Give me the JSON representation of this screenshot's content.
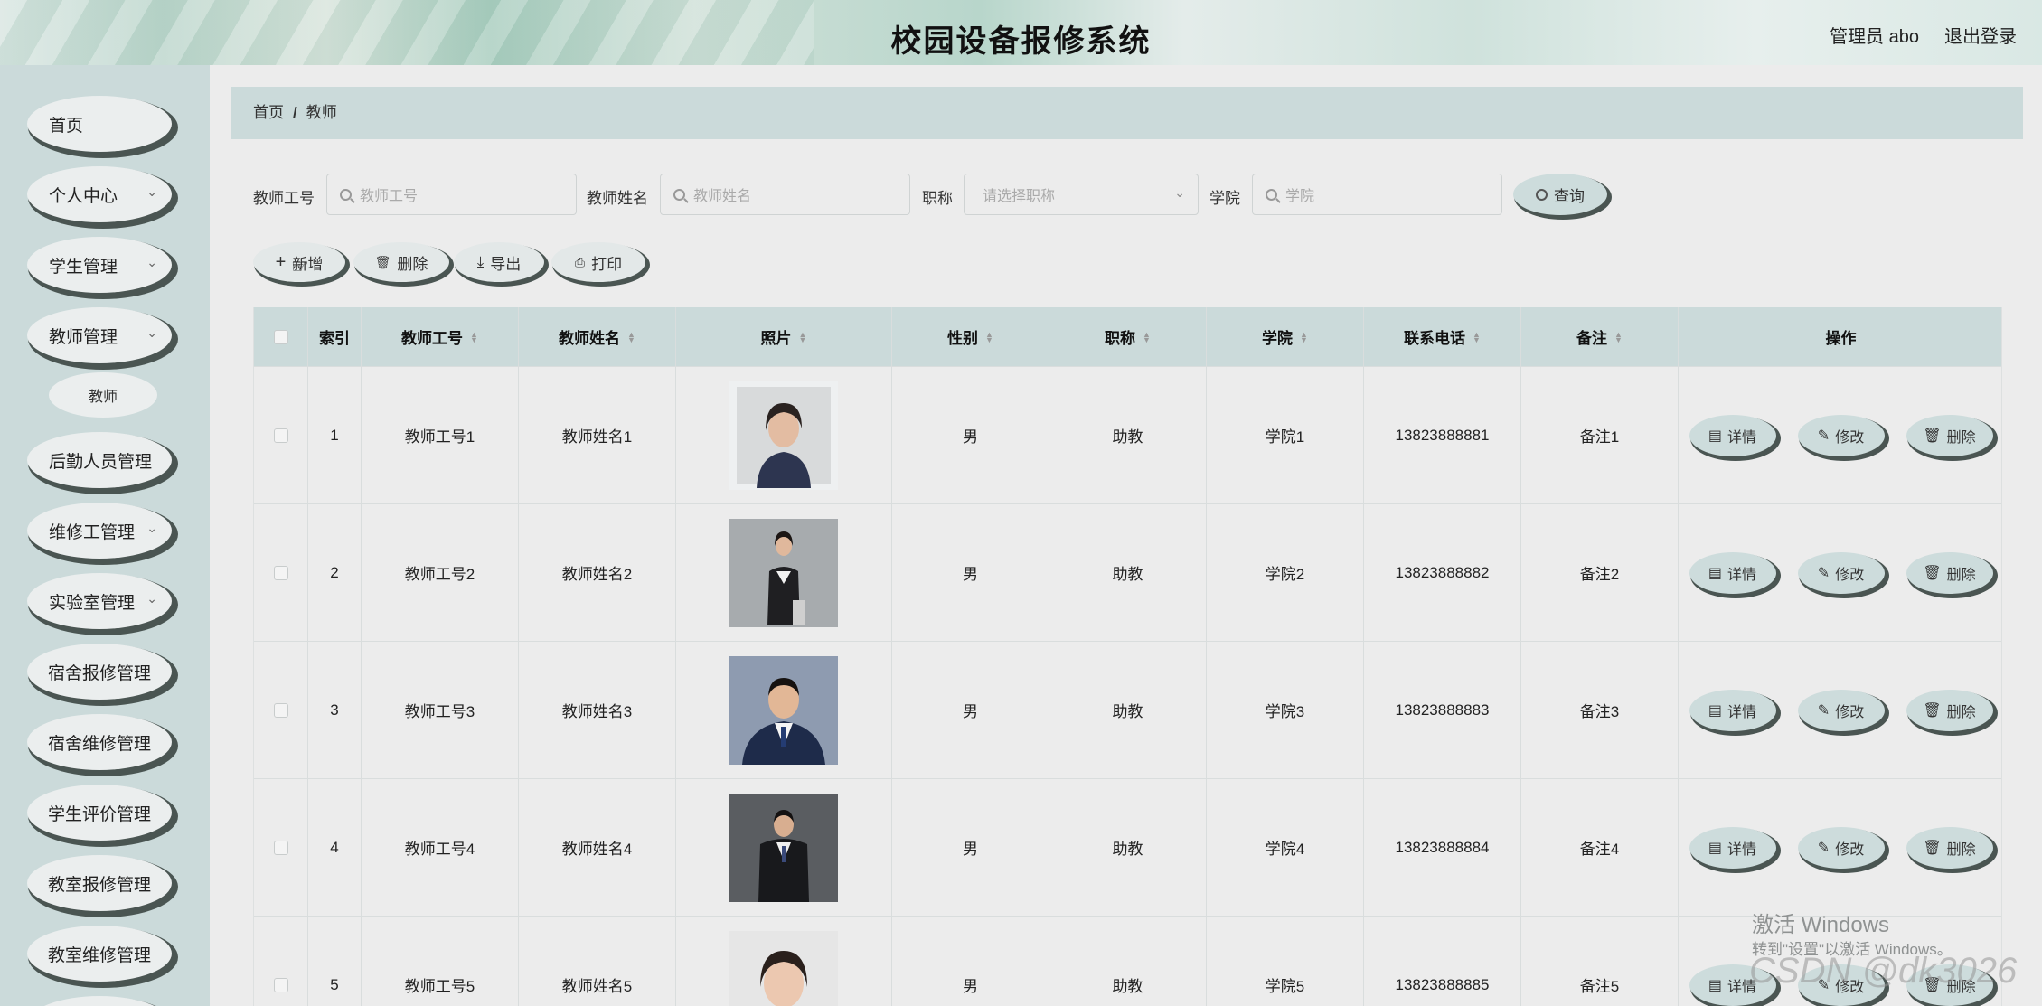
{
  "header": {
    "title": "校园设备报修系统",
    "user": "管理员 abo",
    "logout": "退出登录"
  },
  "sidebar": {
    "items": [
      {
        "label": "首页",
        "chevron": false
      },
      {
        "label": "个人中心",
        "chevron": true
      },
      {
        "label": "学生管理",
        "chevron": true
      },
      {
        "label": "教师管理",
        "chevron": true
      },
      {
        "label": "后勤人员管理",
        "chevron": false
      },
      {
        "label": "维修工管理",
        "chevron": true
      },
      {
        "label": "实验室管理",
        "chevron": true
      },
      {
        "label": "宿舍报修管理",
        "chevron": false
      },
      {
        "label": "宿舍维修管理",
        "chevron": false
      },
      {
        "label": "学生评价管理",
        "chevron": false
      },
      {
        "label": "教室报修管理",
        "chevron": false
      },
      {
        "label": "教室维修管理",
        "chevron": false
      }
    ],
    "submenu": "教师"
  },
  "breadcrumb": {
    "home": "首页",
    "sep": "/",
    "current": "教师"
  },
  "filters": {
    "no_label": "教师工号",
    "no_placeholder": "教师工号",
    "name_label": "教师姓名",
    "name_placeholder": "教师姓名",
    "title_label": "职称",
    "title_placeholder": "请选择职称",
    "college_label": "学院",
    "college_placeholder": "学院",
    "search": "查询"
  },
  "toolbar": {
    "add": "新增",
    "delete": "删除",
    "export": "导出",
    "print": "打印"
  },
  "table": {
    "columns": [
      "索引",
      "教师工号",
      "教师姓名",
      "照片",
      "性别",
      "职称",
      "学院",
      "联系电话",
      "备注",
      "操作"
    ],
    "rows": [
      {
        "idx": "1",
        "no": "教师工号1",
        "name": "教师姓名1",
        "gender": "男",
        "title": "助教",
        "college": "学院1",
        "phone": "13823888881",
        "note": "备注1"
      },
      {
        "idx": "2",
        "no": "教师工号2",
        "name": "教师姓名2",
        "gender": "男",
        "title": "助教",
        "college": "学院2",
        "phone": "13823888882",
        "note": "备注2"
      },
      {
        "idx": "3",
        "no": "教师工号3",
        "name": "教师姓名3",
        "gender": "男",
        "title": "助教",
        "college": "学院3",
        "phone": "13823888883",
        "note": "备注3"
      },
      {
        "idx": "4",
        "no": "教师工号4",
        "name": "教师姓名4",
        "gender": "男",
        "title": "助教",
        "college": "学院4",
        "phone": "13823888884",
        "note": "备注4"
      },
      {
        "idx": "5",
        "no": "教师工号5",
        "name": "教师姓名5",
        "gender": "男",
        "title": "助教",
        "college": "学院5",
        "phone": "13823888885",
        "note": "备注5"
      }
    ],
    "actions": {
      "detail": "详情",
      "edit": "修改",
      "delete": "删除"
    }
  },
  "watermark": {
    "line1": "激活 Windows",
    "line2": "转到\"设置\"以激活 Windows。",
    "line3": "CSDN @dk3026"
  },
  "colors": {
    "accent": "#cbdada",
    "shadow": "#4a5552",
    "background": "#ececec"
  }
}
